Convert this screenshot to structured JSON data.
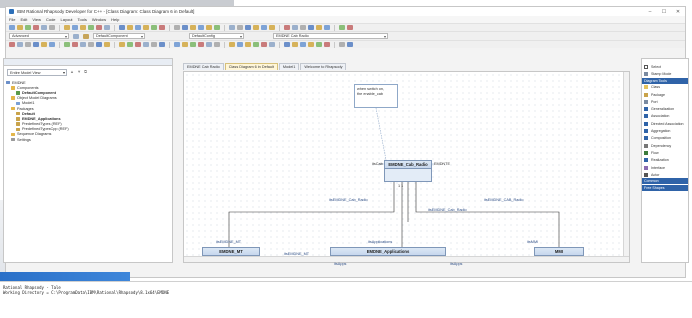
{
  "window": {
    "title": "IBM Rational Rhapsody Developer for C++ - [Class Diagram: Class Diagram 6 in Default]",
    "controls": [
      "–",
      "☐",
      "✕"
    ]
  },
  "menu": [
    "File",
    "Edit",
    "View",
    "Code",
    "Layout",
    "Tools",
    "Window",
    "Help"
  ],
  "combos": {
    "mode": "Advanced",
    "component": "DefaultComponent",
    "config": "DefaultConfig",
    "node": "EMDNE Cab Radio"
  },
  "browser": {
    "view_select": "Entire Model View",
    "tools": "▲ ▼ ⧉",
    "tree": [
      {
        "label": "EMDNE",
        "indent": 0,
        "bold": false,
        "icon": "project-icon",
        "color": "#6b8fc9"
      },
      {
        "label": "Components",
        "indent": 1,
        "bold": false,
        "icon": "folder-icon",
        "color": "#e3b64a"
      },
      {
        "label": "DefaultComponent",
        "indent": 2,
        "bold": true,
        "icon": "component-icon",
        "color": "#5a9a4a"
      },
      {
        "label": "Object Model Diagrams",
        "indent": 1,
        "bold": false,
        "icon": "folder-icon",
        "color": "#e3b64a"
      },
      {
        "label": "Model1",
        "indent": 2,
        "bold": false,
        "icon": "diagram-icon",
        "color": "#7aa0d6"
      },
      {
        "label": "Packages",
        "indent": 1,
        "bold": false,
        "icon": "folder-icon",
        "color": "#e3b64a"
      },
      {
        "label": "Default",
        "indent": 2,
        "bold": true,
        "icon": "package-icon",
        "color": "#c9a34a"
      },
      {
        "label": "EMDNE_Applications",
        "indent": 2,
        "bold": true,
        "icon": "package-icon",
        "color": "#c9a34a"
      },
      {
        "label": "PredefinedTypes (REF)",
        "indent": 2,
        "bold": false,
        "icon": "package-icon",
        "color": "#c9a34a"
      },
      {
        "label": "PredefinedTypesCpp (REF)",
        "indent": 2,
        "bold": false,
        "icon": "package-icon",
        "color": "#c9a34a"
      },
      {
        "label": "Sequence Diagrams",
        "indent": 1,
        "bold": false,
        "icon": "folder-icon",
        "color": "#e3b64a"
      },
      {
        "label": "Settings",
        "indent": 1,
        "bold": false,
        "icon": "settings-icon",
        "color": "#9a9a9a"
      }
    ]
  },
  "tabs": [
    {
      "label": "EMDNE Cab Radio",
      "active": false
    },
    {
      "label": "Class Diagram 6 in Default",
      "active": true
    },
    {
      "label": "Model1",
      "active": false
    },
    {
      "label": "Welcome to Rhapsody",
      "active": false
    }
  ],
  "diagram": {
    "note_lines": [
      "when switch on,",
      "the enable_cab"
    ],
    "cab_radio": {
      "name": "EMDNE_Cab_Radio"
    },
    "mt": {
      "name": "EMDNE_MT"
    },
    "apps": {
      "name": "EMDNE_Applications"
    },
    "mmi": {
      "name": "MMI"
    },
    "labels": {
      "top_left": "itsCab",
      "top_right": "EMDNTE",
      "multiplicity": "1   1",
      "mid_left": "itsEMDNE_Cab_Radio",
      "mid_center": "itsEMDNE_Cab_Radio",
      "mid_right": "itsEMDNE_CAB_Radio",
      "mt_role": "itsEMDNE_MT",
      "mt_end": "itsEMDNE_MT",
      "apps_role": "itsApplications",
      "mmi_role": "itsMMI",
      "apps_left": "itsApps",
      "apps_right": "itsApps",
      "mt_mult": "1",
      "apps_mult": "1",
      "mmi_mult": "1"
    }
  },
  "palette": {
    "items": [
      {
        "label": "Select",
        "icon": "cursor-icon"
      },
      {
        "label": "Stamp Mode",
        "icon": "stamp-icon"
      }
    ],
    "header": "Diagram Tools",
    "tools": [
      {
        "label": "Class",
        "icon": "class-icon"
      },
      {
        "label": "Package",
        "icon": "package-icon"
      },
      {
        "label": "Port",
        "icon": "port-icon"
      },
      {
        "label": "Generalization",
        "icon": "generalization-icon"
      },
      {
        "label": "Association",
        "icon": "association-icon"
      },
      {
        "label": "Directed Association",
        "icon": "directed-association-icon"
      },
      {
        "label": "Aggregation",
        "icon": "aggregation-icon"
      },
      {
        "label": "Composition",
        "icon": "composition-icon"
      },
      {
        "label": "Dependency",
        "icon": "dependency-icon"
      },
      {
        "label": "Flow",
        "icon": "flow-icon"
      },
      {
        "label": "Realization",
        "icon": "realization-icon"
      },
      {
        "label": "Interface",
        "icon": "interface-icon"
      },
      {
        "label": "Actor",
        "icon": "actor-icon"
      }
    ],
    "footer_headers": [
      "Common",
      "Free Shapes"
    ]
  },
  "output": {
    "lines": [
      "Rational Rhapsody - Tale",
      "Working Directory = C:\\ProgramData\\IBM\\Rational\\Rhapsody\\8.1x64\\EMDNE"
    ]
  }
}
